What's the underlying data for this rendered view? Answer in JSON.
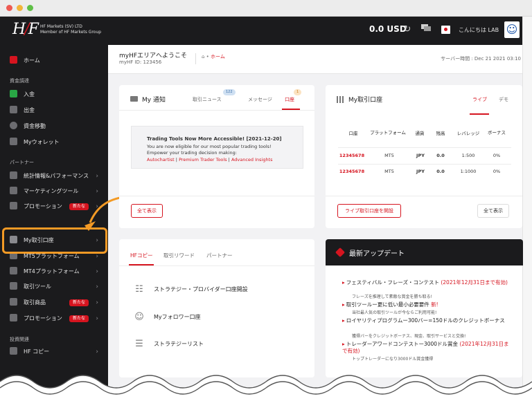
{
  "colors": {
    "brand_red": "#d6141f",
    "dark": "#1b1b1d",
    "highlight": "#f39a25"
  },
  "topbar": {
    "company_line1": "HF Markets (SV) LTD",
    "company_line2": "Member of HF Markets Group",
    "balance": "0.0 USD",
    "greeting": "こんにちは LAB",
    "icons": [
      "refresh-icon",
      "chat-icon",
      "japan-flag-icon",
      "user-avatar-icon"
    ]
  },
  "sidebar": {
    "home": "ホーム",
    "section_funds": "資金調達",
    "deposit": "入金",
    "withdraw": "出金",
    "transfer": "資金移動",
    "wallet": "Myウォレット",
    "section_partner": "パートナー",
    "stats": "統計情報&パフォーマンス",
    "marketing": "マーケティングツール",
    "promo": "プロモーション",
    "new_badge": "新たな",
    "my_accounts": "My取引口座",
    "mt5": "MT5プラットフォーム",
    "mt4": "MT4プラットフォーム",
    "tools": "取引ツール",
    "products": "取引商品",
    "promo2": "プロモーション",
    "section_invest": "投資関連",
    "hfcopy": "HF コピー"
  },
  "header": {
    "welcome": "myHFエリアへようこそ",
    "hf_id": "myHF ID: 123456",
    "breadcrumb": "ホーム",
    "server_time": "サーバー時間 : Dec 21 2021 03:10"
  },
  "notifications": {
    "title": "My 通知",
    "tabs": [
      {
        "label": "取引ニュース",
        "count": "122"
      },
      {
        "label": "メッセージ",
        "count": ""
      },
      {
        "label": "口座",
        "count": "1"
      }
    ],
    "notice_title": "Trading Tools Now More Accessible! [2021-12-20]",
    "notice_line1": "You are now eligible for our most popular trading tools!",
    "notice_line2": "Empower your trading decision making:",
    "links": [
      "Autochartist",
      "Premium Trader Tools",
      "Advanced Insights"
    ],
    "link_sep": " | ",
    "view_all": "全て表示"
  },
  "accounts": {
    "title": "My取引口座",
    "tabs": [
      "ライブ",
      "デモ"
    ],
    "headers": [
      "口座",
      "プラットフォーム",
      "通貨",
      "残高",
      "レバレッジ",
      "ボーナス"
    ],
    "rows": [
      [
        "12345678",
        "MT5",
        "JPY",
        "0.0",
        "1:500",
        "0%"
      ],
      [
        "12345678",
        "MT5",
        "JPY",
        "0.0",
        "1:1000",
        "0%"
      ]
    ],
    "open_live": "ライブ取引口座を開設",
    "view_all": "全て表示"
  },
  "hfcopy_card": {
    "tabs": [
      "HFコピー",
      "取引リワード",
      "パートナー"
    ],
    "items": [
      "ストラテジー・プロバイダー口座開設",
      "Myフォロワー口座",
      "ストラテジーリスト"
    ]
  },
  "news": {
    "title": "最新アップデート",
    "items": [
      {
        "text": "フェスティバル・フレーズ・コンテスト",
        "tag": "(2021年12月31日まで有効)",
        "sub": "フレーズを推理して素敵な賞金を勝ち取る!"
      },
      {
        "text": "取引ツールー更に低い最小必要要件",
        "tag": "新!",
        "sub": "当社最人気の取引ツールが今ならご利用可能!"
      },
      {
        "text": "ロイヤリティプログラムー300バー=150ドルのクレジットボーナス",
        "tag": "",
        "sub": "獲得バーをクレジットボーナス、現金、取引サービスと交換!"
      },
      {
        "text": "トレーダーアワードコンテストー3000ドル賞金",
        "tag": "(2021年12月31日まで有効)",
        "sub": "トップトレーダーになり3000ドル賞金獲得"
      }
    ]
  }
}
